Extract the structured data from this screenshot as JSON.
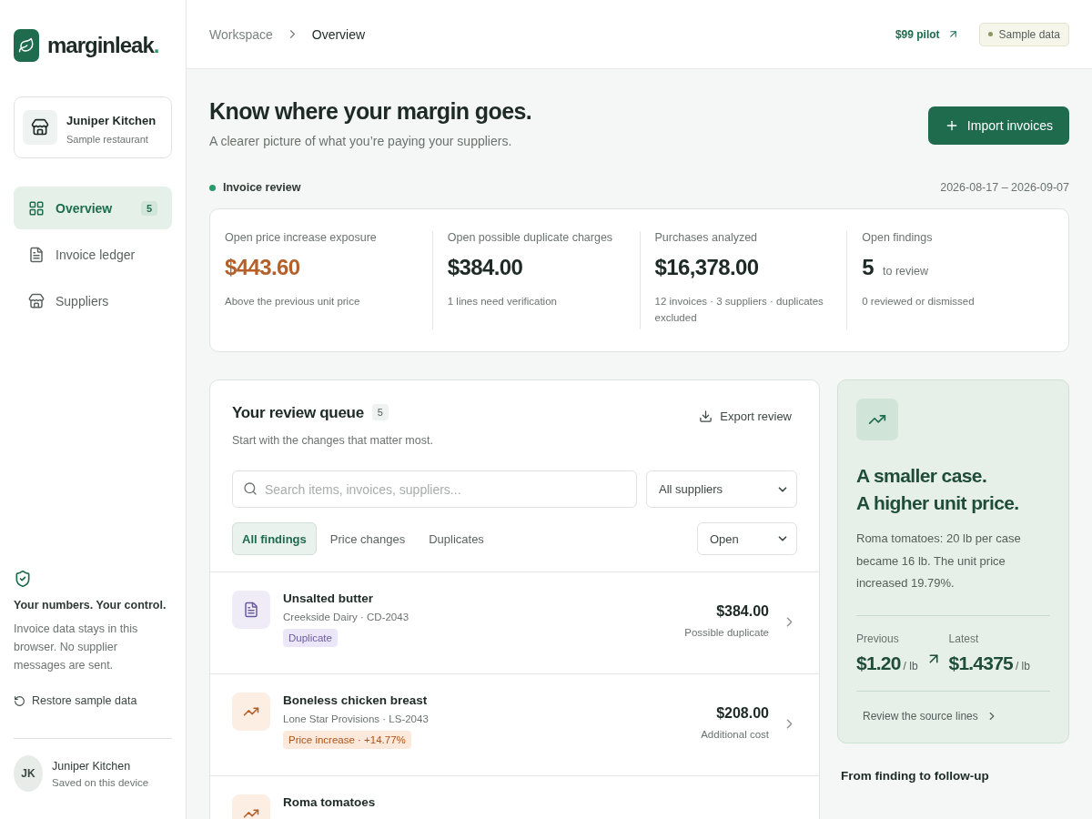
{
  "brand": {
    "name": "marginleak",
    "mark": "."
  },
  "org": {
    "name": "Juniper Kitchen",
    "subtitle": "Sample restaurant"
  },
  "nav": [
    {
      "label": "Overview",
      "selected": true,
      "badge": "5"
    },
    {
      "label": "Invoice ledger",
      "selected": false
    },
    {
      "label": "Suppliers",
      "selected": false
    }
  ],
  "privacy": {
    "title": "Your numbers. Your control.",
    "text": "Invoice data stays in this browser. No supplier messages are sent.",
    "action": "Restore sample data"
  },
  "user": {
    "initials": "JK",
    "name": "Juniper Kitchen",
    "status": "Saved on this device"
  },
  "breadcrumb": [
    "Workspace",
    "Overview"
  ],
  "header": {
    "pilot": "$99 pilot",
    "badge": "Sample data"
  },
  "hero": {
    "title": "Know where your margin goes.",
    "subtitle": "A clearer picture of what you’re paying your suppliers.",
    "button": "Import invoices"
  },
  "period": {
    "label": "Invoice review",
    "range": "2026-08-17 – 2026-09-07"
  },
  "stats": [
    {
      "label": "Open price increase exposure",
      "value": "$443.60",
      "highlighted": true,
      "note": "Above the previous unit price"
    },
    {
      "label": "Open possible duplicate charges",
      "value": "$384.00",
      "highlighted": false,
      "note": "1 lines need verification"
    },
    {
      "label": "Purchases analyzed",
      "value": "$16,378.00",
      "highlighted": false,
      "note": "12 invoices · 3 suppliers · duplicates excluded"
    },
    {
      "label": "Open findings",
      "value": "5",
      "unit": "to review",
      "highlighted": false,
      "note": "0 reviewed or dismissed"
    }
  ],
  "queue": {
    "title": "Your review queue",
    "count": "5",
    "subtitle": "Start with the changes that matter most.",
    "export": "Export review",
    "search": {
      "placeholder": "Search items, invoices, suppliers..."
    },
    "supplier_filter": "All suppliers",
    "tabs": [
      {
        "label": "All findings",
        "selected": true
      },
      {
        "label": "Price changes",
        "selected": false
      },
      {
        "label": "Duplicates",
        "selected": false
      }
    ],
    "status_filter": "Open",
    "findings": [
      {
        "kind": "duplicate",
        "name": "Unsalted butter",
        "meta": "Creekside Dairy · CD-2043",
        "tag": "Duplicate",
        "amount": "$384.00",
        "amount_label": "Possible duplicate"
      },
      {
        "kind": "price_increase",
        "name": "Boneless chicken breast",
        "meta": "Lone Star Provisions · LS-2043",
        "tag": "Price increase · +14.77%",
        "amount": "$208.00",
        "amount_label": "Additional cost"
      },
      {
        "kind": "price_increase",
        "name": "Roma tomatoes"
      }
    ]
  },
  "insight": {
    "title_lines": [
      "A smaller case.",
      "A higher unit price."
    ],
    "text": "Roma tomatoes: 20 lb per case became 16 lb. The unit price increased 19.79%.",
    "previous": {
      "label": "Previous",
      "value": "$1.20",
      "unit": "/ lb"
    },
    "latest": {
      "label": "Latest",
      "value": "$1.4375",
      "unit": "/ lb"
    },
    "link": "Review the source lines"
  },
  "followup_title": "From finding to follow-up"
}
